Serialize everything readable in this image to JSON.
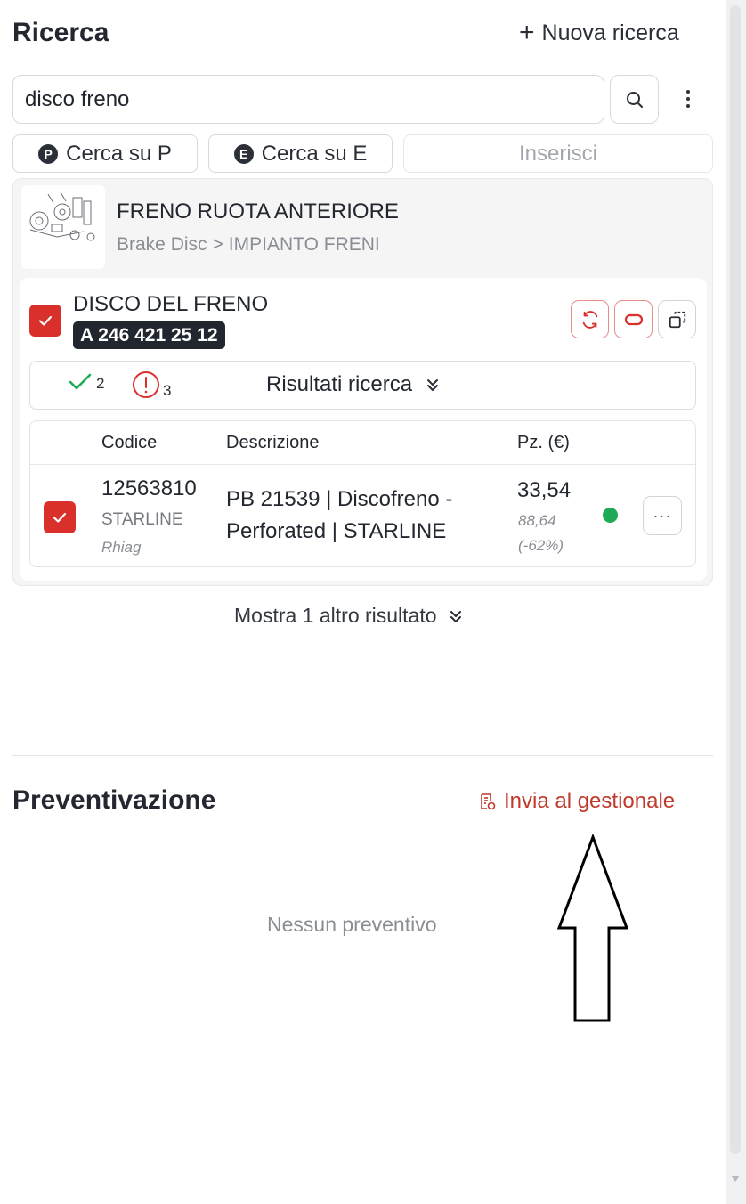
{
  "search_section": {
    "title": "Ricerca",
    "new_search_label": "Nuova ricerca",
    "query_value": "disco freno",
    "buttons": {
      "search_p": {
        "badge": "P",
        "label": "Cerca su P"
      },
      "search_e": {
        "badge": "E",
        "label": "Cerca su E"
      },
      "insert": {
        "label": "Inserisci"
      }
    }
  },
  "result": {
    "category_title": "FRENO RUOTA ANTERIORE",
    "breadcrumb": {
      "parent": "Brake Disc",
      "separator": ">",
      "child": "IMPIANTO FRENI"
    },
    "part": {
      "name": "DISCO DEL FRENO",
      "code": "A 246 421 25 12",
      "checked": true
    },
    "summary": {
      "ok_count": "2",
      "warning_count": "3",
      "label": "Risultati ricerca"
    },
    "table": {
      "headers": [
        "Codice",
        "Descrizione",
        "Pz. (€)"
      ],
      "rows": [
        {
          "code": "12563810",
          "brand": "STARLINE",
          "supplier": "Rhiag",
          "description": "PB 21539 | Discofreno - Perforated | STARLINE",
          "price": "33,54",
          "list_price": "88,64",
          "discount": "(-62%)",
          "checked": true
        }
      ]
    },
    "show_more_label": "Mostra 1 altro risultato"
  },
  "quote_section": {
    "title": "Preventivazione",
    "send_label": "Invia al gestionale",
    "empty_text": "Nessun preventivo"
  },
  "colors": {
    "accent_red": "#d9302b",
    "link_red": "#c0392b",
    "status_green": "#1faa55",
    "dark": "#22262e"
  },
  "icons": [
    "plus-icon",
    "search-icon",
    "kebab-icon",
    "checkmark-icon",
    "refresh-icon",
    "link-icon",
    "copy-icon",
    "check-icon",
    "alert-icon",
    "chevrons-down-icon",
    "invoice-icon",
    "arrow-annotation"
  ]
}
